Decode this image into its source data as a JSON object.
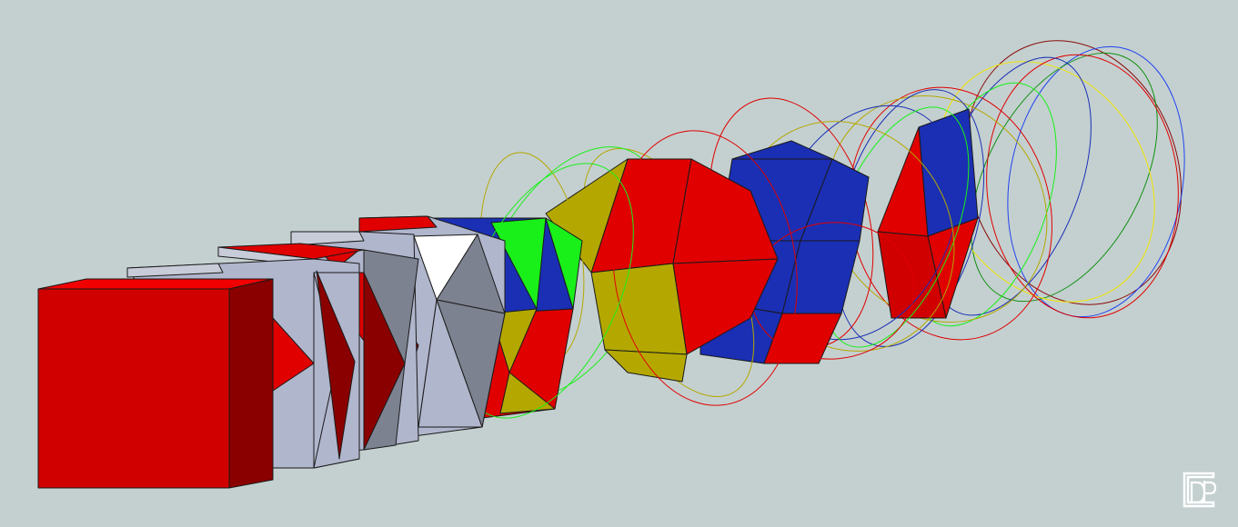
{
  "scene": {
    "background": "#c4d0d0",
    "palette": {
      "red": "#e00000",
      "dark_red": "#8a0000",
      "maroon": "#8b0a0a",
      "light_gray": "#b0b6cc",
      "mid_gray": "#7d8290",
      "white": "#ffffff",
      "blue": "#1a2fb4",
      "bright_blue": "#2244ee",
      "green": "#19f019",
      "dark_green": "#109010",
      "olive": "#b4a800",
      "yellow": "#f0e600"
    },
    "sequence": [
      "cube",
      "truncated-cube",
      "cuboctahedron",
      "truncated-octahedron",
      "octahedron-with-rings",
      "icosahedron-with-rings",
      "nested-ring-cage",
      "ring-cage"
    ]
  },
  "logo": {
    "icon": "dp-monogram-icon",
    "color": "#ffffff"
  }
}
